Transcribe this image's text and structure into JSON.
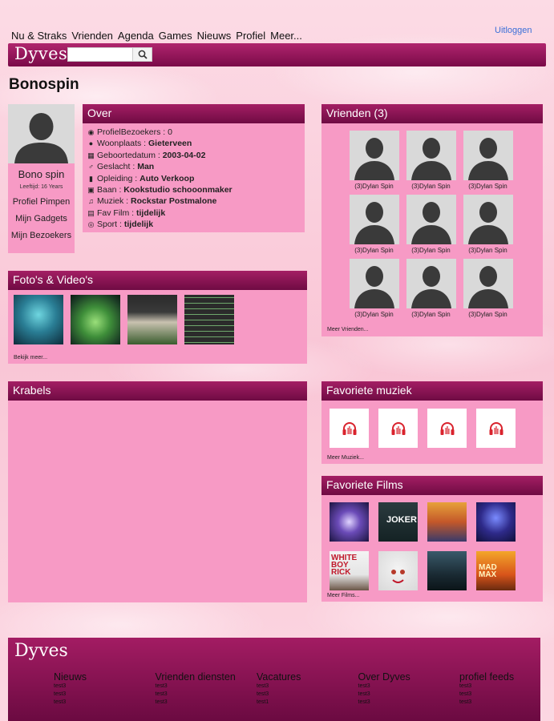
{
  "topnav": {
    "items": [
      "Nu & Straks",
      "Vrienden",
      "Agenda",
      "Games",
      "Nieuws",
      "Profiel",
      "Meer..."
    ],
    "logout": "Uitloggen"
  },
  "header": {
    "logo": "Dyves",
    "search_placeholder": ""
  },
  "profile": {
    "username": "Bonospin",
    "display_name": "Bono spin",
    "age": "Leeftijd: 16 Years",
    "links": [
      "Profiel Pimpen",
      "Mijn Gadgets",
      "Mijn Bezoekers"
    ]
  },
  "over": {
    "title": "Over",
    "rows": [
      {
        "icon": "eye-icon",
        "label": "ProfielBezoekers : ",
        "value": "0",
        "bold": false
      },
      {
        "icon": "globe-icon",
        "label": "Woonplaats : ",
        "value": "Gieterveen",
        "bold": true
      },
      {
        "icon": "calendar-icon",
        "label": "Geboortedatum : ",
        "value": "2003-04-02",
        "bold": true
      },
      {
        "icon": "male-icon",
        "label": "Geslacht : ",
        "value": "Man",
        "bold": true
      },
      {
        "icon": "book-icon",
        "label": "Opleiding : ",
        "value": "Auto Verkoop",
        "bold": true
      },
      {
        "icon": "money-icon",
        "label": "Baan : ",
        "value": "Kookstudio schooonmaker",
        "bold": true
      },
      {
        "icon": "music-icon",
        "label": "Muziek : ",
        "value": "Rockstar Postmalone",
        "bold": true
      },
      {
        "icon": "film-icon",
        "label": "Fav Film : ",
        "value": "tijdelijk",
        "bold": true
      },
      {
        "icon": "soccer-ball-icon",
        "label": "Sport : ",
        "value": "tijdelijk",
        "bold": true
      }
    ]
  },
  "vrienden": {
    "title": "Vrienden (3)",
    "friends": [
      "(3)Dylan Spin",
      "(3)Dylan Spin",
      "(3)Dylan Spin",
      "(3)Dylan Spin",
      "(3)Dylan Spin",
      "(3)Dylan Spin",
      "(3)Dylan Spin",
      "(3)Dylan Spin",
      "(3)Dylan Spin"
    ],
    "more": "Meer Vrienden..."
  },
  "fotos": {
    "title": "Foto's & Video's",
    "more": "Bekijk meer..."
  },
  "krabels": {
    "title": "Krabels"
  },
  "muziek": {
    "title": "Favoriete muziek",
    "more": "Meer Muziek..."
  },
  "films": {
    "title": "Favoriete Films",
    "more": "Meer Films...",
    "poster_texts": [
      "",
      "JOKER",
      "",
      "",
      "WHITE BOY RICK",
      "",
      "",
      "MAD MAX"
    ]
  },
  "footer": {
    "logo": "Dyves",
    "columns": [
      {
        "title": "Nieuws",
        "items": [
          "test3",
          "test3",
          "test3"
        ]
      },
      {
        "title": "Vrienden diensten",
        "items": [
          "test3",
          "test3",
          "test3"
        ]
      },
      {
        "title": "Vacatures",
        "items": [
          "test3",
          "test3",
          "test1"
        ]
      },
      {
        "title": "Over Dyves",
        "items": [
          "test3",
          "test3",
          "test3"
        ]
      },
      {
        "title": "profiel feeds",
        "items": [
          "test3",
          "test3",
          "test3"
        ]
      }
    ]
  },
  "colors": {
    "panel_bg": "#f79ac5",
    "header_dark": "#7a0a48",
    "accent_link": "#3a6fd8",
    "music_red": "#d9232d"
  }
}
